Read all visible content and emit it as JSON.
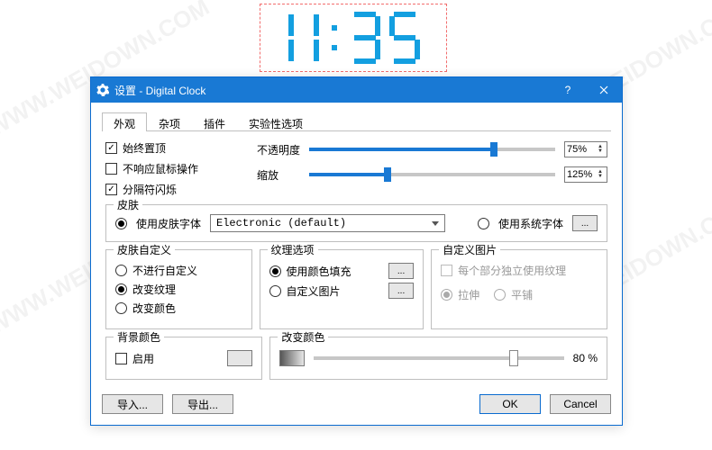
{
  "clock": {
    "time": "11:35"
  },
  "dialog": {
    "title": "设置 - Digital Clock",
    "tabs": [
      "外观",
      "杂项",
      "插件",
      "实验性选项"
    ],
    "active_tab": 0,
    "checks": {
      "always_on_top": "始终置顶",
      "no_mouse": "不响应鼠标操作",
      "sep_blink": "分隔符闪烁"
    },
    "opacity_label": "不透明度",
    "opacity_value": "75%",
    "zoom_label": "缩放",
    "zoom_value": "125%",
    "skin_group": "皮肤",
    "use_skin_font": "使用皮肤字体",
    "skin_select": "Electronic (default)",
    "use_system_font": "使用系统字体",
    "customize_group": "皮肤自定义",
    "cust_none": "不进行自定义",
    "cust_texture": "改变纹理",
    "cust_color": "改变颜色",
    "texture_group": "纹理选项",
    "tex_fill": "使用颜色填充",
    "tex_image": "自定义图片",
    "image_group": "自定义图片",
    "img_per_part": "每个部分独立使用纹理",
    "img_stretch": "拉伸",
    "img_tile": "平铺",
    "bg_group": "背景颜色",
    "bg_enable": "启用",
    "change_group": "改变颜色",
    "change_value": "80 %",
    "import": "导入...",
    "export": "导出...",
    "ok": "OK",
    "cancel": "Cancel"
  }
}
